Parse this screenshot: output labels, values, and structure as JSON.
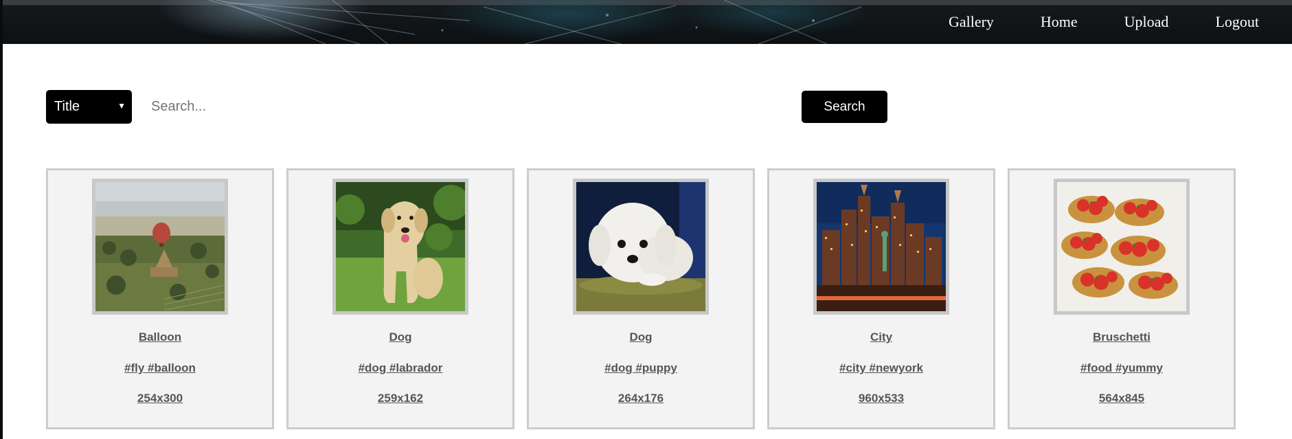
{
  "nav": {
    "items": [
      "Gallery",
      "Home",
      "Upload",
      "Logout"
    ]
  },
  "search": {
    "filter_selected": "Title",
    "placeholder": "Search...",
    "button_label": "Search"
  },
  "cards": [
    {
      "title": "Balloon",
      "tags": "#fly #balloon",
      "size": "254x300",
      "image": "balloon-photo"
    },
    {
      "title": "Dog",
      "tags": "#dog #labrador",
      "size": "259x162",
      "image": "labrador-photo"
    },
    {
      "title": "Dog",
      "tags": "#dog #puppy",
      "size": "264x176",
      "image": "puppy-photo"
    },
    {
      "title": "City",
      "tags": "#city #newyork",
      "size": "960x533",
      "image": "city-photo"
    },
    {
      "title": "Bruschetti",
      "tags": "#food #yummy",
      "size": "564x845",
      "image": "bruschetta-photo"
    }
  ],
  "colors": {
    "nav_background": "#0c1013",
    "button_background": "#000000",
    "card_background": "#f3f3f3",
    "card_border": "#cccccc",
    "link_text": "#555555"
  }
}
